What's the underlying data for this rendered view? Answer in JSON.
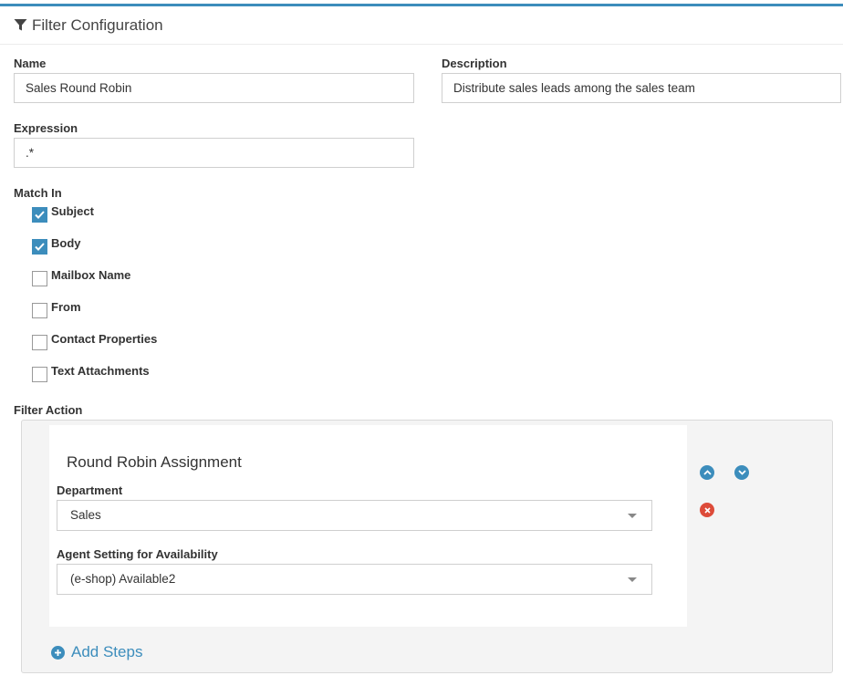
{
  "header": {
    "title": "Filter Configuration",
    "icon": "filter-icon"
  },
  "form": {
    "name": {
      "label": "Name",
      "value": "Sales Round Robin"
    },
    "description": {
      "label": "Description",
      "value": "Distribute sales leads among the sales team"
    },
    "expression": {
      "label": "Expression",
      "value": ".*"
    },
    "match_in": {
      "label": "Match In",
      "options": [
        {
          "label": "Subject",
          "checked": true
        },
        {
          "label": "Body",
          "checked": true
        },
        {
          "label": "Mailbox Name",
          "checked": false
        },
        {
          "label": "From",
          "checked": false
        },
        {
          "label": "Contact Properties",
          "checked": false
        },
        {
          "label": "Text Attachments",
          "checked": false
        }
      ]
    }
  },
  "filter_action": {
    "label": "Filter Action",
    "step": {
      "title": "Round Robin Assignment",
      "department": {
        "label": "Department",
        "value": "Sales"
      },
      "agent_setting": {
        "label": "Agent Setting for Availability",
        "value": "(e-shop) Available2"
      }
    },
    "add_steps_label": "Add Steps"
  },
  "colors": {
    "accent": "#3c8dbc",
    "danger": "#dd4b39"
  }
}
